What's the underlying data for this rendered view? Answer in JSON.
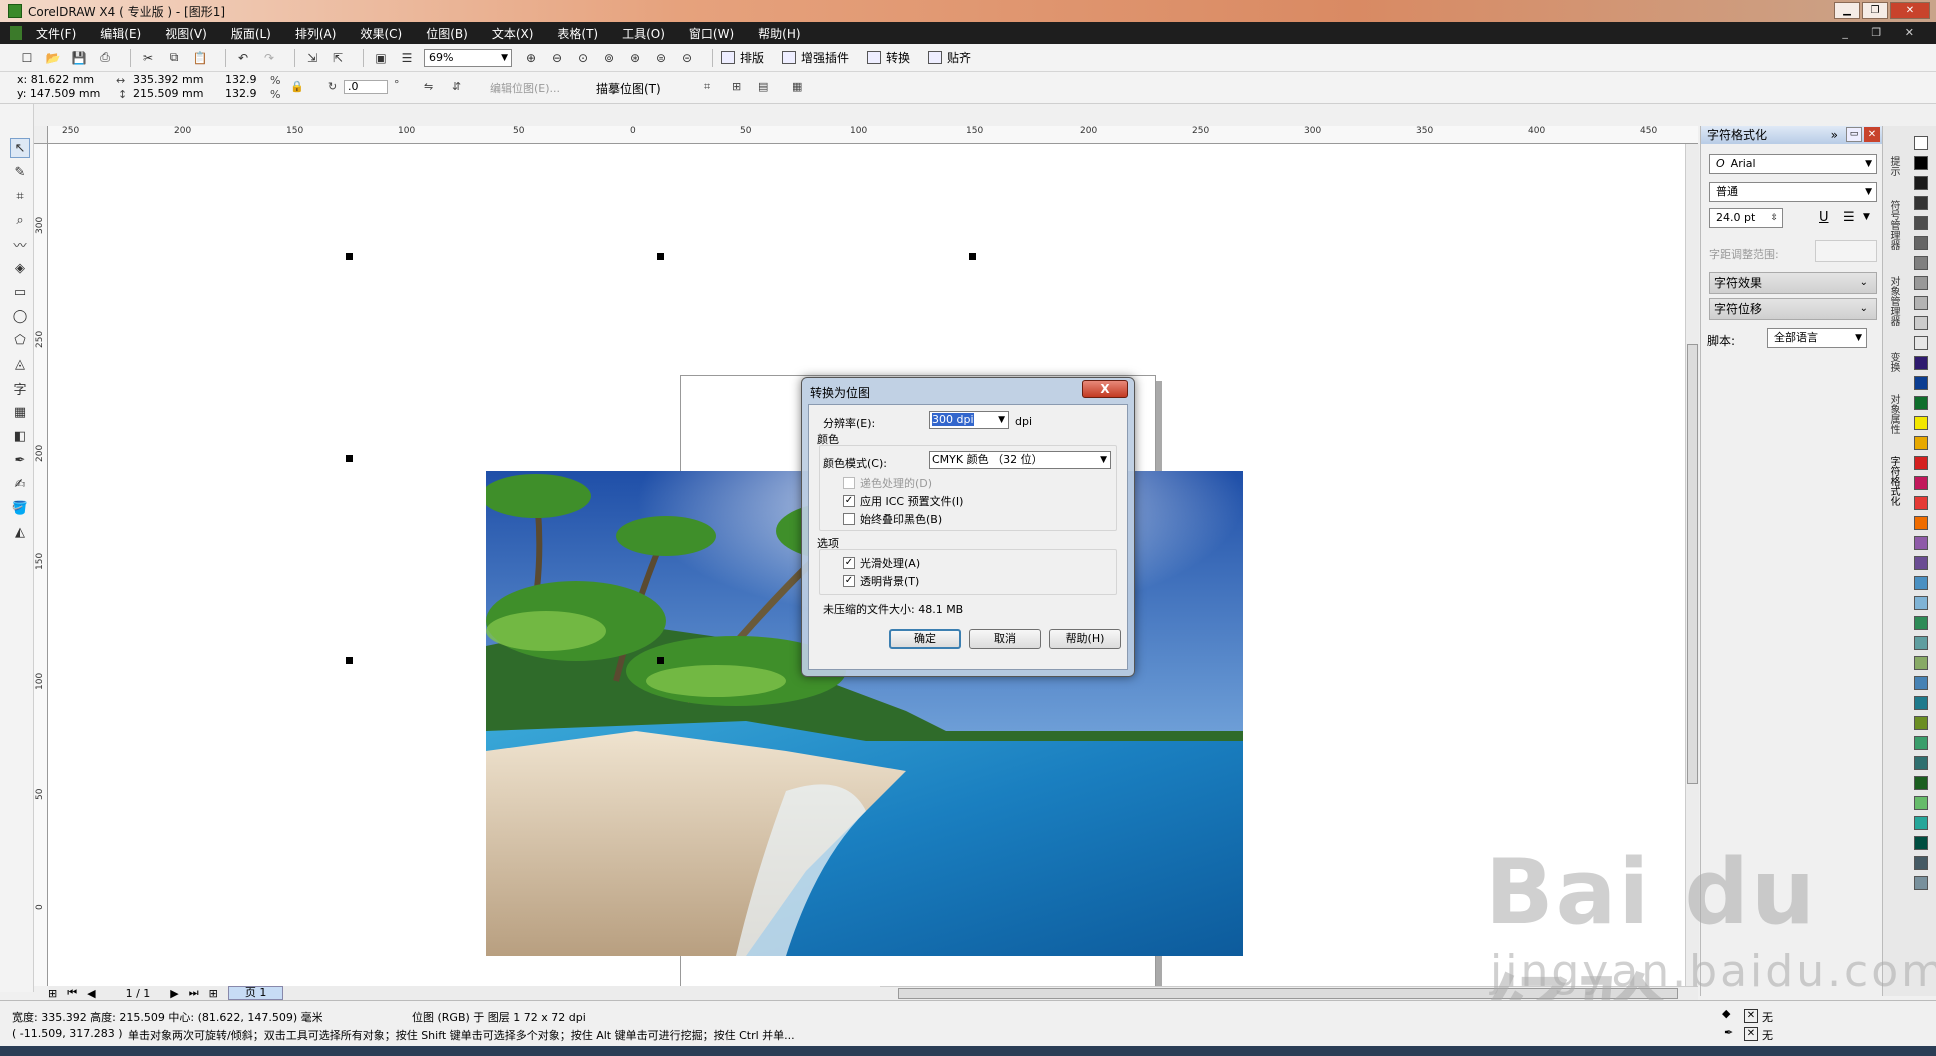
{
  "window": {
    "title": "CorelDRAW X4 ( 专业版 ) - [图形1]"
  },
  "menu": [
    "文件(F)",
    "编辑(E)",
    "视图(V)",
    "版面(L)",
    "排列(A)",
    "效果(C)",
    "位图(B)",
    "文本(X)",
    "表格(T)",
    "工具(O)",
    "窗口(W)",
    "帮助(H)"
  ],
  "toolbar": {
    "zoom": "69%",
    "text_buttons": [
      "排版",
      "增强插件",
      "转换",
      "贴齐"
    ]
  },
  "properties": {
    "x": "x: 81.622 mm",
    "y": "y: 147.509 mm",
    "width": "335.392 mm",
    "height": "215.509 mm",
    "scale_w": "132.9",
    "scale_h": "132.9",
    "percent": "%",
    "rotation": ".0",
    "degree": "°",
    "edit_bitmap": "编辑位图(E)...",
    "trace_bitmap": "描摹位图(T)"
  },
  "ruler": {
    "h_ticks": [
      "250",
      "200",
      "150",
      "100",
      "50",
      "0",
      "50",
      "100",
      "150",
      "200",
      "250",
      "300",
      "350",
      "400",
      "450"
    ],
    "v_ticks": [
      "300",
      "250",
      "200",
      "150",
      "100",
      "50",
      "0"
    ],
    "unit": "毫米"
  },
  "page_nav": {
    "counter": "1 / 1",
    "tab": "页 1"
  },
  "docker": {
    "title": "字符格式化",
    "font": "Arial",
    "style": "普通",
    "size": "24.0 pt",
    "tracking_label": "字距调整范围:",
    "effects": "字符效果",
    "shift": "字符位移",
    "script_label": "脚本:",
    "script_value": "全部语言",
    "tabs": [
      "提示",
      "符号管理器",
      "对象管理器",
      "变换",
      "对象属性",
      "字符格式化"
    ]
  },
  "palette": {
    "colors": [
      "#ffffff",
      "#000000",
      "#1a1a1a",
      "#333333",
      "#4d4d4d",
      "#666666",
      "#808080",
      "#999999",
      "#b3b3b3",
      "#cccccc",
      "#e6e6e6",
      "#2e1a6e",
      "#0b3d91",
      "#0f6e2c",
      "#f2e600",
      "#e6a800",
      "#d42020",
      "#c2185b",
      "#e53935",
      "#ef6c00",
      "#8e5aa8",
      "#6a4c93",
      "#4a90c2",
      "#7fb3d5",
      "#2e8b57",
      "#5f9ea0",
      "#88aa66",
      "#4682b4",
      "#1f7a8c",
      "#6b8e23",
      "#3a9d6b",
      "#2f6f6f",
      "#1b5e20",
      "#66bb6a",
      "#26a69a",
      "#004d40",
      "#455a64",
      "#78909c"
    ]
  },
  "dialog": {
    "title": "转换为位图",
    "close": "X",
    "resolution_label": "分辨率(E):",
    "resolution_value": "300 dpi",
    "resolution_unit": "dpi",
    "color_group": "颜色",
    "color_mode_label": "颜色模式(C):",
    "color_mode_value": "CMYK 颜色 （32 位）",
    "dither": "递色处理的(D)",
    "icc": "应用 ICC 预置文件(I)",
    "overprint": "始终叠印黑色(B)",
    "options_group": "选项",
    "antialias": "光滑处理(A)",
    "transparent": "透明背景(T)",
    "filesize": "未压缩的文件大小: 48.1 MB",
    "ok": "确定",
    "cancel": "取消",
    "help": "帮助(H)"
  },
  "status": {
    "line1": "宽度: 335.392  高度: 215.509  中心: (81.622, 147.509)  毫米",
    "object": "位图 (RGB) 于 图层 1  72 x 72 dpi",
    "line2": "( -11.509, 317.283 )",
    "hint": "单击对象两次可旋转/倾斜；双击工具可选择所有对象；按住 Shift 键单击可选择多个对象；按住 Alt 键单击可进行挖掘；按住 Ctrl 并单...",
    "fill": "无",
    "outline": "无"
  },
  "watermark": {
    "logo": "Bai du 经验",
    "url": "jingyan.baidu.com"
  }
}
